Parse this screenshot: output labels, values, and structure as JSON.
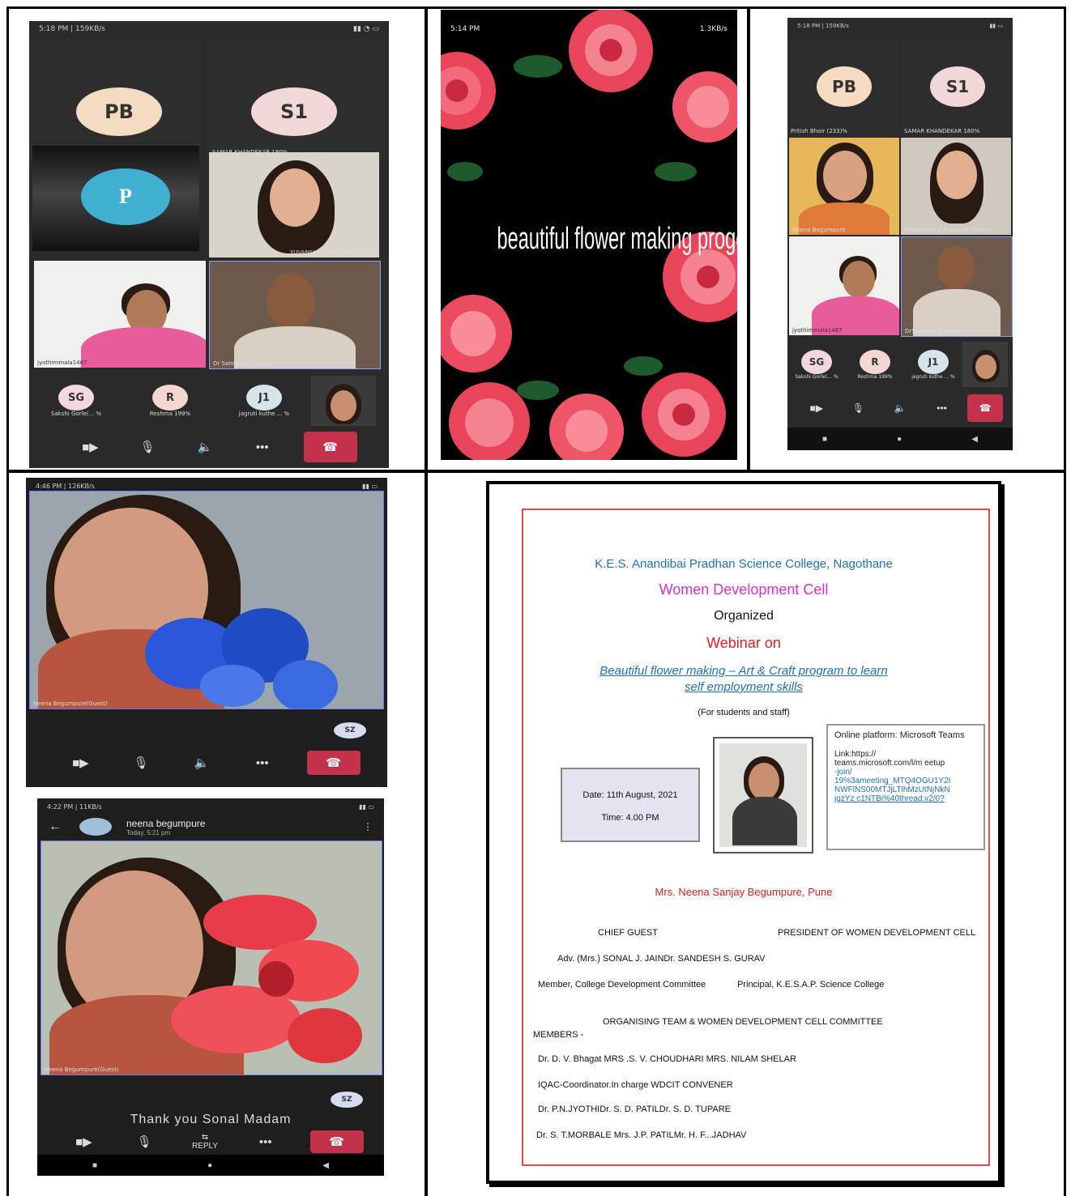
{
  "colors": {
    "brand_blue": "#1f6fc0",
    "magenta": "#d433c6",
    "red_heading": "#e02020",
    "poster_border": "#e04a55",
    "hangup": "#c4314b",
    "call_bg": "#2a2a2a"
  },
  "call1": {
    "status_left": "5:18 PM | 159KB/s",
    "avatars": [
      {
        "initials": "PB",
        "name": "",
        "color": "#f5dcc0"
      },
      {
        "initials": "S1",
        "name": "SAMAR KHANDEKAR 180%",
        "color": "#f2d7d9"
      }
    ],
    "self_initial": "P",
    "tiles": [
      {
        "name": "YUVANSHU JITESH JAIN (Extern..."
      },
      {
        "name": "jyothimmala1467"
      },
      {
        "name": "Dr Sandesh S. Gurav"
      }
    ],
    "participants": [
      {
        "initials": "SG",
        "name": "Sakshi Gorle(... %"
      },
      {
        "initials": "R",
        "name": "Reshma 199%"
      },
      {
        "initials": "J1",
        "name": "jagruti kuthe ... %"
      }
    ]
  },
  "flower_slide": {
    "status_left": "5:14 PM",
    "status_right": "1.3KB/s",
    "title": "beautiful flower making progem"
  },
  "call2": {
    "status_left": "5:18 PM | 159KB/s",
    "avatars": [
      {
        "initials": "PB",
        "name": "Pritish Bhoir (233)%",
        "color": "#f5dcc0"
      },
      {
        "initials": "S1",
        "name": "SAMAR KHANDEKAR 180%",
        "color": "#f2d7d9"
      }
    ],
    "tiles": [
      {
        "name": "Neena Begumpure"
      },
      {
        "name": "YUVANSHU JITESH JAIN (Extern..."
      },
      {
        "name": "jyothimmala1467"
      },
      {
        "name": "DrSandesh S. Gurav"
      }
    ],
    "participants": [
      {
        "initials": "SG",
        "name": "Sakshi Gorle(... %"
      },
      {
        "initials": "R",
        "name": "Reshma 199%"
      },
      {
        "initials": "J1",
        "name": "jagruti kuthe ... %"
      }
    ]
  },
  "call3": {
    "status_left": "4:46 PM | 126KB/s",
    "tile_name": "Neena Begumpure(Guest)",
    "self_initials": "SZ"
  },
  "call4": {
    "status_left": "4:22 PM | 11KB/s",
    "caller_name": "neena begumpure",
    "caller_sub": "Today, 5:21 pm",
    "tile_name": "Neena Begumpure(Guest)",
    "self_initials": "SZ",
    "caption": "Thank you Sonal Madam",
    "reply_label": "REPLY"
  },
  "poster": {
    "college": "K.E.S. Anandibai Pradhan Science College, Nagothane",
    "cell": "Women Development Cell",
    "organized": "Organized",
    "webinar": "Webinar on",
    "topic_line1": "Beautiful flower making – Art & Craft program to  learn",
    "topic_line2": "self employment skills",
    "audience": "(For students and staff)",
    "date": "Date: 11th August, 2021",
    "time": "Time: 4.00 PM",
    "platform": "Online platform: Microsoft Teams",
    "link_label": "Link:https://",
    "link_lines": [
      "teams.microsoft.com/l/m eetup",
      "-join/",
      "19%3ameeting_MTQ4OGU1Y2I",
      "NWFlNS00MTJjLTlhMzUtNjNkN",
      "jgzYz c1NTBi%40thread.v2/0?"
    ],
    "speaker": "Mrs. Neena Sanjay Begumpure, Pune",
    "chief_guest_label": "CHIEF GUEST",
    "president_label": "PRESIDENT OF WOMEN DEVELOPMENT CELL",
    "guests_line": "Adv. (Mrs.) SONAL J. JAINDr. SANDESH S. GURAV",
    "roles_left": "Member, College Development Committee",
    "roles_right": "Principal, K.E.S.A.P. Science College",
    "team_label": "ORGANISING TEAM & WOMEN DEVELOPMENT CELL COMMITTEE",
    "members_label": "MEMBERS -",
    "member_lines": [
      "Dr. D. V. Bhagat  MRS .S. V. CHOUDHARI   MRS. NILAM SHELAR",
      "IQAC-Coordinator.In charge WDCIT   CONVENER",
      "Dr. P.N.JYOTHIDr. S. D. PATILDr. S. D. TUPARE",
      "Dr. S. T.MORBALE  Mrs. J.P. PATILMr. H. F...JADHAV"
    ]
  }
}
